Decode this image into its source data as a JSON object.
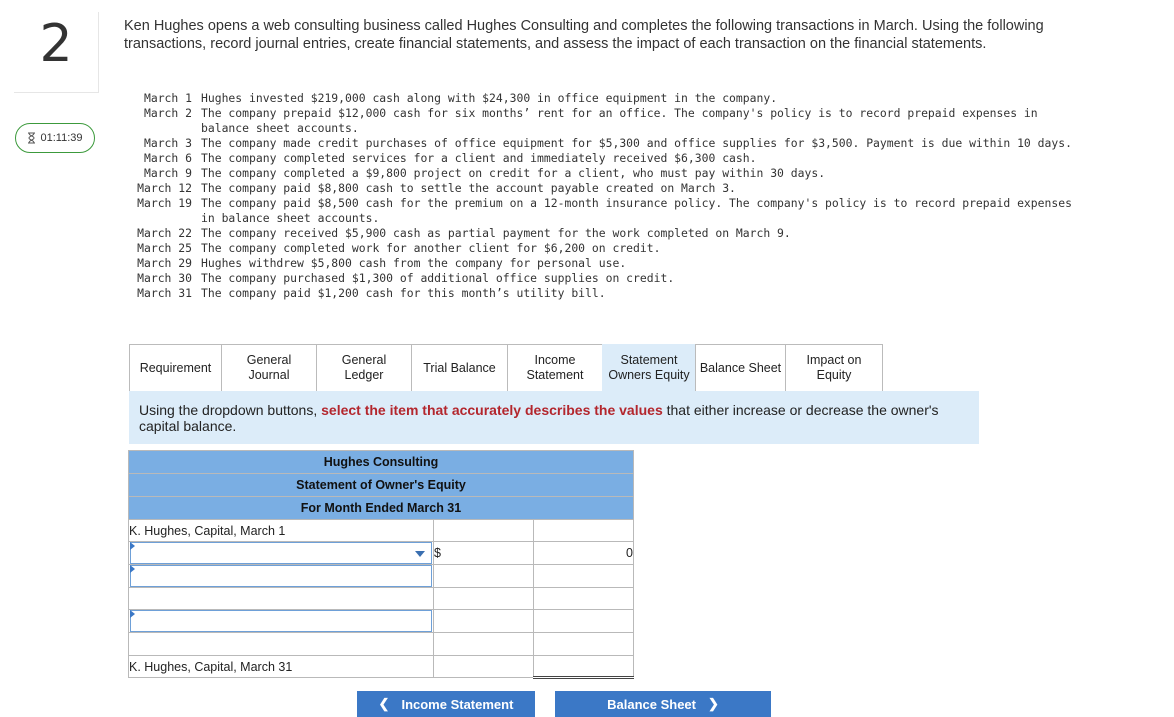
{
  "question": {
    "number": "2"
  },
  "timer": {
    "value": "01:11:39",
    "icon": "hourglass-icon"
  },
  "intro": "Ken Hughes opens a web consulting business called Hughes Consulting and completes the following transactions in March. Using the following transactions, record journal entries, create financial statements, and assess the impact of each transaction on  the financial statements.",
  "transactions": [
    {
      "date": "March 1",
      "text": "Hughes invested $219,000 cash along with $24,300 in office equipment in the company."
    },
    {
      "date": "March 2",
      "text": "The company prepaid $12,000 cash for six months’ rent for an office. The company's policy is to record prepaid expenses in balance sheet accounts."
    },
    {
      "date": "March 3",
      "text": "The company made credit purchases of office equipment for $5,300 and office supplies for $3,500. Payment is due within 10 days."
    },
    {
      "date": "March 6",
      "text": "The company completed services for a client and immediately received $6,300 cash."
    },
    {
      "date": "March 9",
      "text": "The company completed a $9,800 project on credit for a client, who must pay within 30 days."
    },
    {
      "date": "March 12",
      "text": "The company paid $8,800 cash to settle the account payable created on March 3."
    },
    {
      "date": "March 19",
      "text": "The company paid $8,500 cash for the premium on a 12-month insurance policy. The company's policy is to record prepaid expenses in balance sheet accounts."
    },
    {
      "date": "March 22",
      "text": "The company received $5,900 cash as partial payment for the work completed on March 9."
    },
    {
      "date": "March 25",
      "text": "The company completed work for another client for $6,200 on credit."
    },
    {
      "date": "March 29",
      "text": "Hughes withdrew $5,800 cash from the company for personal use."
    },
    {
      "date": "March 30",
      "text": "The company purchased $1,300 of additional office supplies on credit."
    },
    {
      "date": "March 31",
      "text": "The company paid $1,200 cash for this month’s utility bill."
    }
  ],
  "tabs": [
    {
      "line1": "Requirement",
      "line2": ""
    },
    {
      "line1": "General",
      "line2": "Journal"
    },
    {
      "line1": "General",
      "line2": "Ledger"
    },
    {
      "line1": "Trial Balance",
      "line2": ""
    },
    {
      "line1": "Income",
      "line2": "Statement"
    },
    {
      "line1": "Statement",
      "line2": "Owners Equity"
    },
    {
      "line1": "Balance Sheet",
      "line2": ""
    },
    {
      "line1": "Impact on",
      "line2": "Equity"
    }
  ],
  "instruction": {
    "before": "Using the dropdown buttons, ",
    "bold": "select the item that accurately describes the values",
    "after": " that either increase or decrease the owner's capital balance."
  },
  "statement": {
    "company": "Hughes Consulting",
    "title": "Statement of Owner's Equity",
    "period": "For Month Ended March 31",
    "opening_label": "K. Hughes, Capital, March 1",
    "dollar": "$",
    "amount": "0",
    "closing_label": "K. Hughes, Capital, March 31"
  },
  "nav": {
    "prev_label": "Income Statement",
    "next_label": "Balance Sheet"
  },
  "colors": {
    "accent": "#3b78c6",
    "header": "#7aaee3",
    "tab_active": "#dcecf9",
    "emphasis": "#b3262d"
  }
}
